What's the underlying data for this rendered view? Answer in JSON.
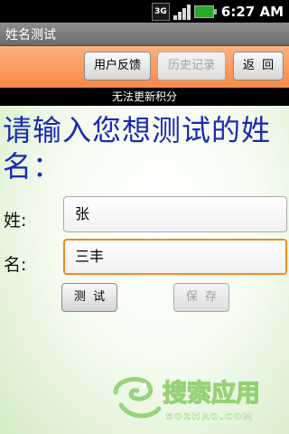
{
  "status_bar": {
    "network": "3G",
    "time": "6:27 AM",
    "icons": [
      "3g-icon",
      "signal-icon",
      "battery-icon"
    ]
  },
  "window": {
    "title": "姓名测试"
  },
  "toolbar": {
    "feedback_label": "用户反馈",
    "history_label": "历史记录",
    "back_label": "返  回"
  },
  "notice": {
    "text": "无法更新积分"
  },
  "form": {
    "prompt": "请输入您想测试的姓名：",
    "surname_label": "姓:",
    "surname_value": "张",
    "given_name_label": "名:",
    "given_name_value": "三丰"
  },
  "actions": {
    "test_label": "测  试",
    "save_label": "保  存"
  },
  "colors": {
    "toolbar": "#f78a48",
    "prompt_text": "#1a2bb0",
    "focus_border": "#f08a20",
    "watermark": "#7cc45a"
  },
  "watermark": {
    "brand": "搜索应用",
    "domain": "SOZHAO.COM"
  }
}
